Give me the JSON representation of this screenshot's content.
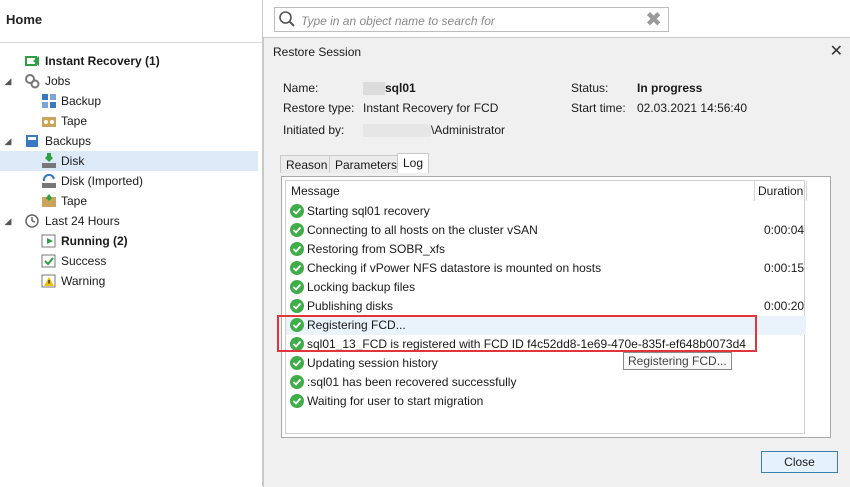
{
  "left_pane": {
    "title": "Home",
    "tree": [
      {
        "label": "Instant Recovery (1)",
        "bold": true,
        "icon": "instant-recovery-icon"
      },
      {
        "label": "Jobs",
        "icon": "jobs-icon"
      },
      {
        "label": "Backup",
        "icon": "backup-job-icon"
      },
      {
        "label": "Tape",
        "icon": "tape-job-icon"
      },
      {
        "label": "Backups",
        "icon": "backups-icon"
      },
      {
        "label": "Disk",
        "icon": "disk-icon",
        "selected": true
      },
      {
        "label": "Disk (Imported)",
        "icon": "disk-imported-icon"
      },
      {
        "label": "Tape",
        "icon": "tape-icon"
      },
      {
        "label": "Last 24 Hours",
        "icon": "last-24-hours-icon"
      },
      {
        "label": "Running (2)",
        "bold": true,
        "icon": "running-icon"
      },
      {
        "label": "Success",
        "icon": "success-icon"
      },
      {
        "label": "Warning",
        "icon": "warning-icon"
      }
    ]
  },
  "search": {
    "placeholder": "Type in an object name to search for"
  },
  "dialog": {
    "title": "Restore Session",
    "name_label": "Name:",
    "name_value": "sql01",
    "restore_type_label": "Restore type:",
    "restore_type_value": "Instant Recovery for FCD",
    "initiated_by_label": "Initiated by:",
    "initiated_by_value": "\\Administrator",
    "status_label": "Status:",
    "status_value": "In progress",
    "start_time_label": "Start time:",
    "start_time_value": "02.03.2021 14:56:40",
    "tabs": [
      "Reason",
      "Parameters",
      "Log"
    ],
    "active_tab": "Log",
    "log": {
      "columns": [
        "Message",
        "Duration"
      ],
      "rows": [
        {
          "message": "Starting        sql01 recovery",
          "duration": ""
        },
        {
          "message": "Connecting to all hosts on the cluster          vSAN",
          "duration": "0:00:04"
        },
        {
          "message": "Restoring from SOBR_xfs",
          "duration": ""
        },
        {
          "message": "Checking if vPower NFS datastore is mounted on hosts",
          "duration": "0:00:15"
        },
        {
          "message": "Locking backup files",
          "duration": ""
        },
        {
          "message": "Publishing disks",
          "duration": "0:00:20"
        },
        {
          "message": "Registering FCD...",
          "duration": ""
        },
        {
          "message": "      sql01_13_FCD is registered with FCD ID f4c52dd8-1e69-470e-835f-ef648b0073d4",
          "duration": ""
        },
        {
          "message": "Updating session history",
          "duration": ""
        },
        {
          "message": "      :sql01 has been recovered successfully",
          "duration": ""
        },
        {
          "message": "Waiting for user to start migration",
          "duration": ""
        }
      ],
      "tooltip": "Registering FCD..."
    },
    "close_label": "Close"
  },
  "colors": {
    "success_green": "#3fae49",
    "highlight_red": "#e0353b",
    "selection_blue": "#dce9f6"
  }
}
